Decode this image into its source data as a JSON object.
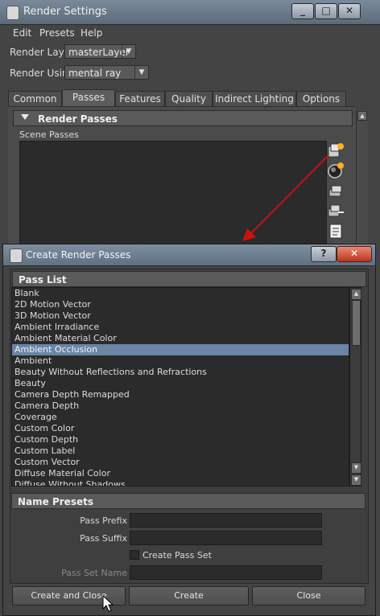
{
  "render_settings": {
    "title": "Render Settings",
    "window_buttons": [
      "_",
      "□",
      "✕"
    ],
    "menu": [
      "Edit",
      "Presets",
      "Help"
    ],
    "render_layer_label": "Render Layer",
    "render_layer_value": "masterLayer",
    "render_using_label": "Render Using",
    "render_using_value": "mental ray",
    "tabs": [
      "Common",
      "Passes",
      "Features",
      "Quality",
      "Indirect Lighting",
      "Options"
    ],
    "active_tab": "Passes",
    "render_passes_header": "Render Passes",
    "scene_passes_label": "Scene Passes"
  },
  "dialog": {
    "title": "Create Render Passes",
    "help_button": "?",
    "close_button": "✕",
    "pass_list_header": "Pass List",
    "pass_list": [
      "Blank",
      "2D Motion Vector",
      "3D Motion Vector",
      "Ambient Irradiance",
      "Ambient Material Color",
      "Ambient Occlusion",
      "Ambient",
      "Beauty Without Reflections and Refractions",
      "Beauty",
      "Camera Depth Remapped",
      "Camera Depth",
      "Coverage",
      "Custom Color",
      "Custom Depth",
      "Custom Label",
      "Custom Vector",
      "Diffuse Material Color",
      "Diffuse Without Shadows"
    ],
    "selected_pass": "Ambient Occlusion",
    "name_presets_header": "Name Presets",
    "pass_prefix_label": "Pass Prefix",
    "pass_prefix_value": "",
    "pass_suffix_label": "Pass Suffix",
    "pass_suffix_value": "",
    "create_pass_set_label": "Create Pass Set",
    "create_pass_set_checked": false,
    "pass_set_name_label": "Pass Set Name",
    "pass_set_name_value": "",
    "buttons": {
      "create_and_close": "Create and Close",
      "create": "Create",
      "close": "Close"
    }
  },
  "colors": {
    "selection": "#6a85a6",
    "arrow": "#cc1111"
  }
}
